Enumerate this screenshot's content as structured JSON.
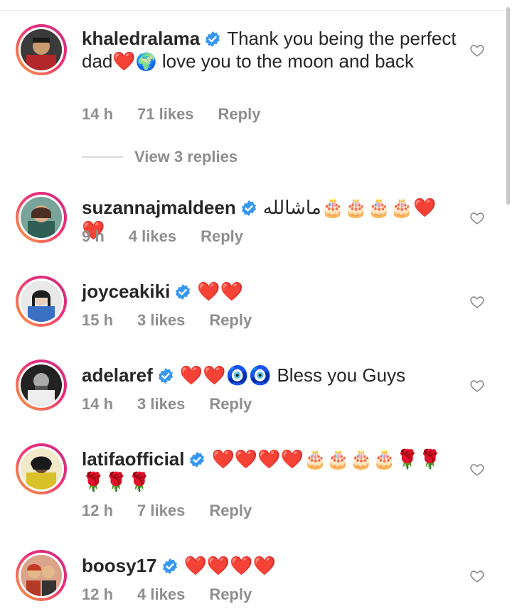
{
  "comments": [
    {
      "username": "khaledralama",
      "text_parts": [
        "Thank you being the perfect dad",
        "❤️",
        "🌍",
        " love you to the moon and back"
      ],
      "time": "14 h",
      "likes": "71 likes",
      "reply": "Reply",
      "view_replies": "View 3 replies",
      "avatar_colors": [
        "#8b2d2d",
        "#c89b6f"
      ]
    },
    {
      "username": "suzannajmaldeen",
      "text": "ماشالله🎂🎂🎂🎂❤️❤️",
      "time": "9 h",
      "likes": "4 likes",
      "reply": "Reply",
      "avatar_colors": [
        "#2f5f55",
        "#d8b08c"
      ]
    },
    {
      "username": "joyceakiki",
      "text": "❤️❤️",
      "time": "15 h",
      "likes": "3 likes",
      "reply": "Reply",
      "avatar_colors": [
        "#3a6fc4",
        "#e7cdbb"
      ]
    },
    {
      "username": "adelaref",
      "text": "❤️❤️🧿🧿 Bless you Guys",
      "time": "14 h",
      "likes": "3 likes",
      "reply": "Reply",
      "avatar_colors": [
        "#222222",
        "#aaaaaa"
      ]
    },
    {
      "username": "latifaofficial",
      "text": "❤️❤️❤️❤️🎂🎂🎂🎂🌹🌹🌹🌹🌹",
      "time": "12 h",
      "likes": "7 likes",
      "reply": "Reply",
      "avatar_colors": [
        "#d9c12a",
        "#6b4b3a"
      ]
    },
    {
      "username": "boosy17",
      "text": "❤️❤️❤️❤️",
      "time": "12 h",
      "likes": "4 likes",
      "reply": "Reply",
      "avatar_colors": [
        "#b53a2a",
        "#e3b98a"
      ]
    }
  ],
  "colors": {
    "verified": "#3897f0",
    "meta_text": "#8e8e8e",
    "username": "#262626",
    "story_ring": [
      "#f9a13a",
      "#ee2a7b"
    ]
  },
  "icons": {
    "verified": "verified-badge-icon",
    "like": "heart-outline-icon"
  }
}
